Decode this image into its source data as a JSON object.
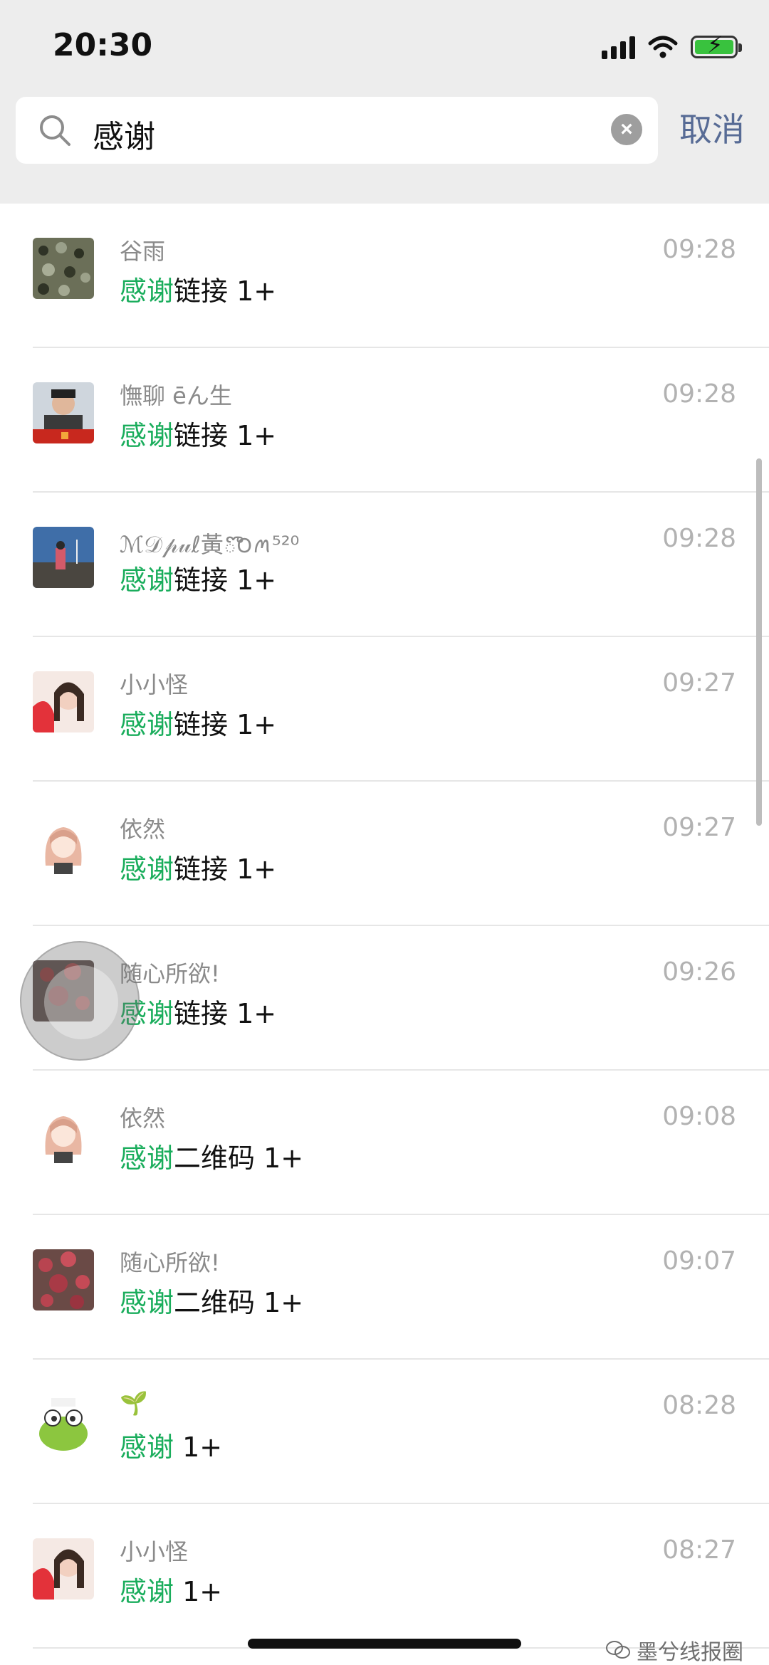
{
  "status_bar": {
    "time": "20:30"
  },
  "search": {
    "query": "感谢",
    "cancel_label": "取消"
  },
  "rows": [
    {
      "name": "谷雨",
      "highlight": "感谢",
      "rest": "链接 1+",
      "time": "09:28",
      "avatar": "avatar-1"
    },
    {
      "name": "憮聊 ēん生",
      "highlight": "感谢",
      "rest": "链接 1+",
      "time": "09:28",
      "avatar": "avatar-2"
    },
    {
      "name": "ℳ𝒟𝓅𝓊ℓ黃ొ౦ꪔ⁵²⁰",
      "highlight": "感谢",
      "rest": "链接 1+",
      "time": "09:28",
      "avatar": "avatar-3"
    },
    {
      "name": "小小怪",
      "highlight": "感谢",
      "rest": "链接 1+",
      "time": "09:27",
      "avatar": "avatar-4"
    },
    {
      "name": "依然",
      "highlight": "感谢",
      "rest": "链接 1+",
      "time": "09:27",
      "avatar": "avatar-5"
    },
    {
      "name": "随心所欲!",
      "highlight": "感谢",
      "rest": "链接 1+",
      "time": "09:26",
      "avatar": "avatar-6"
    },
    {
      "name": "依然",
      "highlight": "感谢",
      "rest": "二维码 1+",
      "time": "09:08",
      "avatar": "avatar-5"
    },
    {
      "name": "随心所欲!",
      "highlight": "感谢",
      "rest": "二维码 1+",
      "time": "09:07",
      "avatar": "avatar-6"
    },
    {
      "name": "🌱",
      "highlight": "感谢",
      "rest": " 1+",
      "time": "08:28",
      "avatar": "avatar-7"
    },
    {
      "name": "小小怪",
      "highlight": "感谢",
      "rest": " 1+",
      "time": "08:27",
      "avatar": "avatar-4"
    }
  ],
  "watermark": "墨兮线报圈",
  "colors": {
    "highlight": "#1aad5c",
    "cancel": "#576b95",
    "top_bg": "#ededed"
  }
}
